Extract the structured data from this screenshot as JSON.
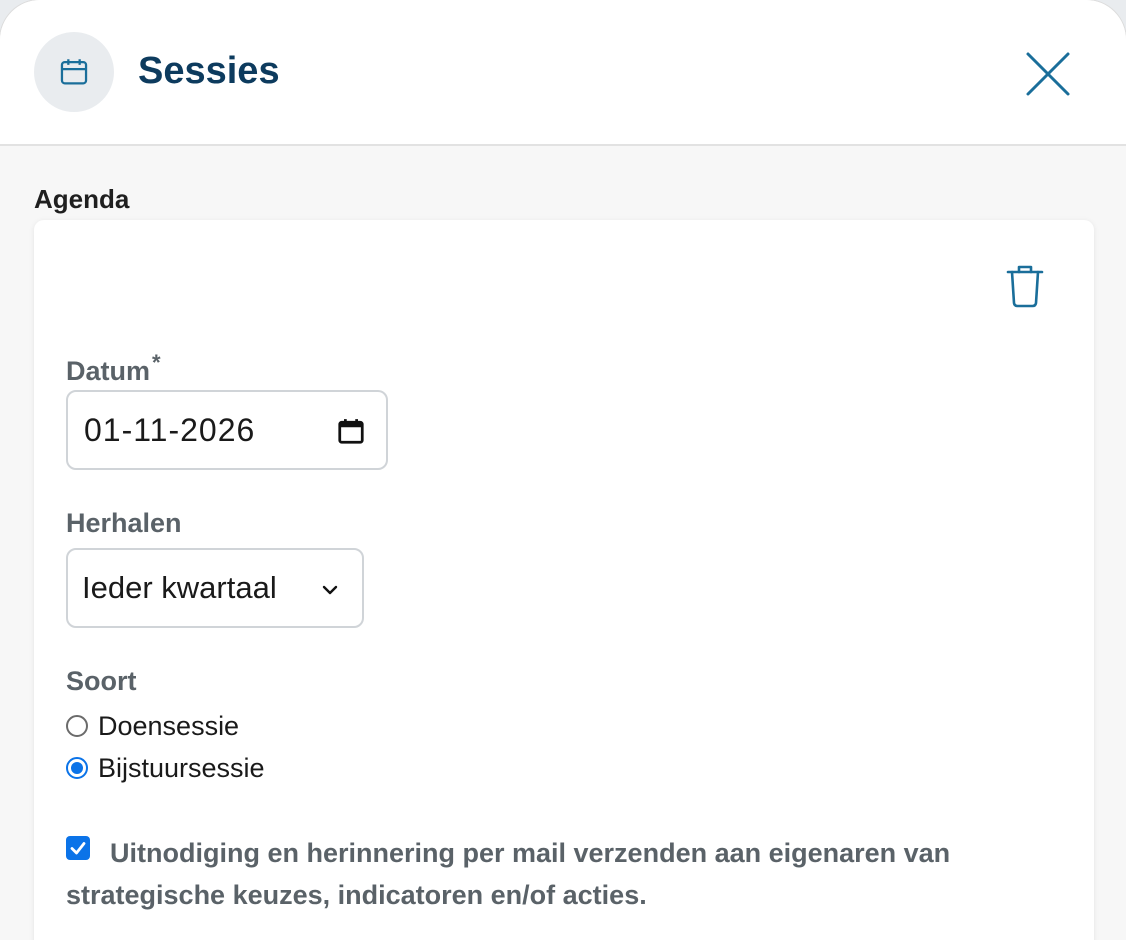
{
  "header": {
    "title": "Sessies",
    "icon": "calendar-icon",
    "close_icon": "close-icon"
  },
  "section": {
    "label": "Agenda"
  },
  "card": {
    "delete_icon": "trash-icon",
    "date": {
      "label": "Datum",
      "required_mark": "*",
      "value": "01-11-2026"
    },
    "repeat": {
      "label": "Herhalen",
      "selected": "Ieder kwartaal"
    },
    "type": {
      "label": "Soort",
      "options": [
        {
          "label": "Doensessie",
          "checked": false
        },
        {
          "label": "Bijstuursessie",
          "checked": true
        }
      ]
    },
    "notify": {
      "checked": true,
      "label": "Uitnodiging en herinnering per mail verzenden aan eigenaren van strategische keuzes, indicatoren en/of acties."
    }
  },
  "colors": {
    "title": "#0d3b5e",
    "accent": "#0b73e8",
    "label_gray": "#5a6268",
    "icon_blue": "#1a6e9a"
  }
}
